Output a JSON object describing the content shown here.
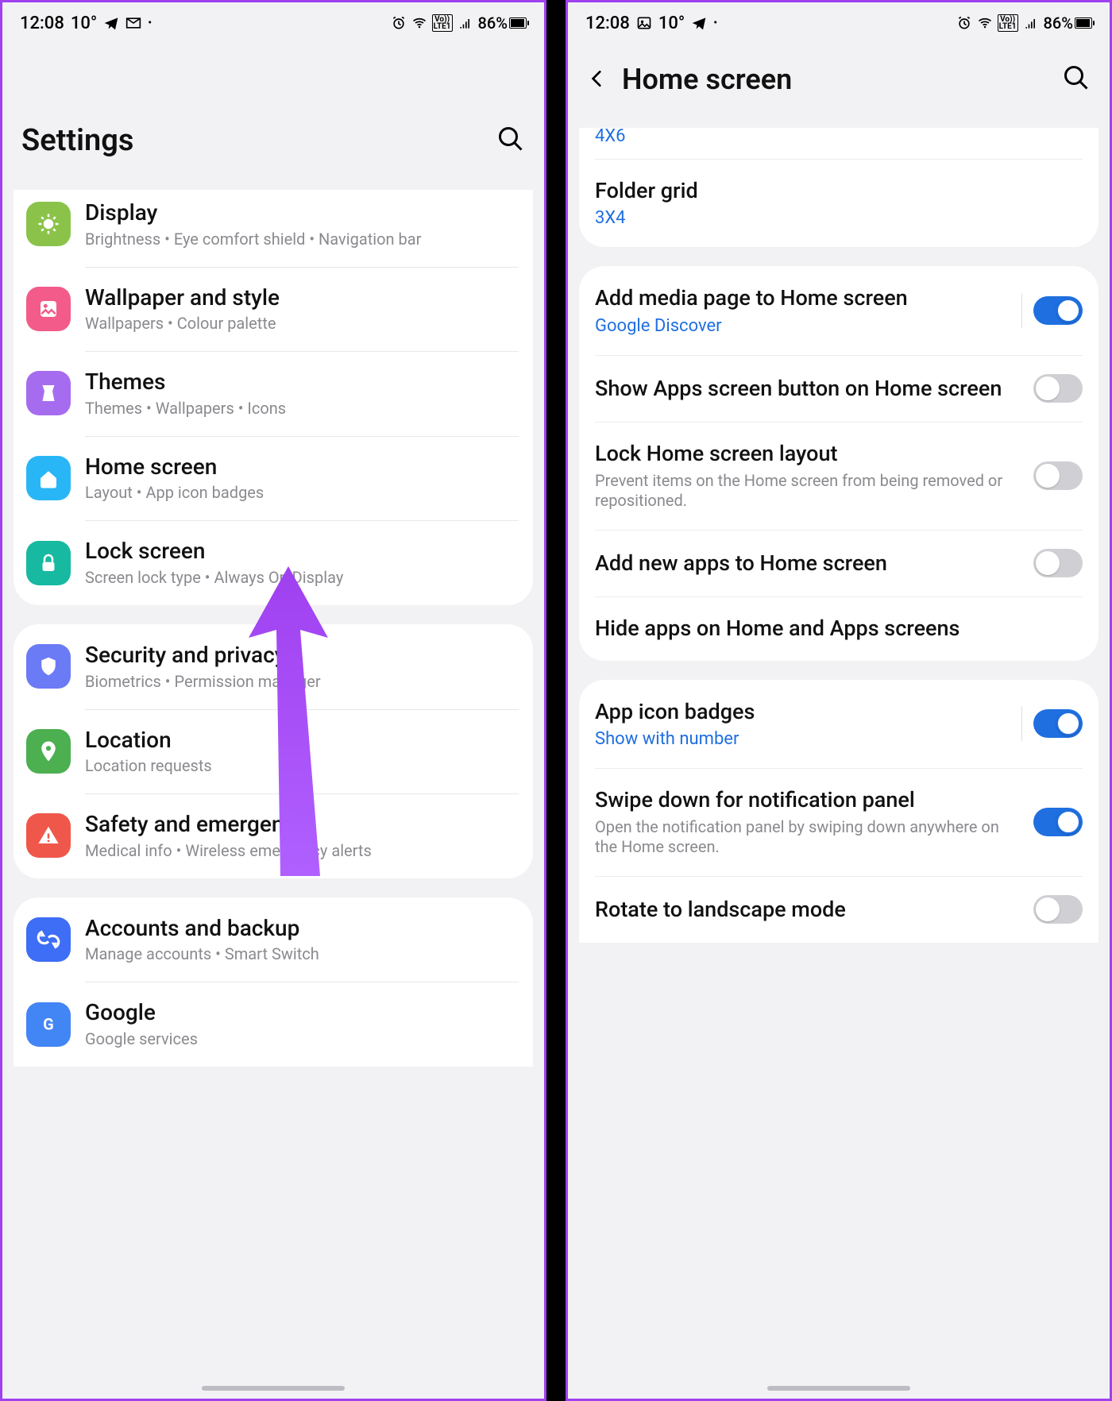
{
  "status": {
    "time": "12:08",
    "temp": "10°",
    "battery_pct": "86%"
  },
  "left": {
    "title": "Settings",
    "items": [
      {
        "title": "Display",
        "sub": "Brightness  •  Eye comfort shield  •  Navigation bar",
        "color": "#8bc34a",
        "icon": "display"
      },
      {
        "title": "Wallpaper and style",
        "sub": "Wallpapers  •  Colour palette",
        "color": "#f35b8a",
        "icon": "wallpaper"
      },
      {
        "title": "Themes",
        "sub": "Themes  •  Wallpapers  •  Icons",
        "color": "#a66cf0",
        "icon": "themes"
      },
      {
        "title": "Home screen",
        "sub": "Layout  •  App icon badges",
        "color": "#29b6f6",
        "icon": "home"
      },
      {
        "title": "Lock screen",
        "sub": "Screen lock type  •  Always On Display",
        "color": "#17b9a0",
        "icon": "lock"
      },
      {
        "title": "Security and privacy",
        "sub": "Biometrics  •  Permission manager",
        "color": "#6b7af5",
        "icon": "shield"
      },
      {
        "title": "Location",
        "sub": "Location requests",
        "color": "#4caf50",
        "icon": "location"
      },
      {
        "title": "Safety and emergency",
        "sub": "Medical info  •  Wireless emergency alerts",
        "color": "#f0574b",
        "icon": "emergency"
      },
      {
        "title": "Accounts and backup",
        "sub": "Manage accounts  •  Smart Switch",
        "color": "#3d6ef5",
        "icon": "backup"
      },
      {
        "title": "Google",
        "sub": "Google services",
        "color": "#4285f4",
        "icon": "google"
      }
    ]
  },
  "right": {
    "title": "Home screen",
    "top_value": "4X6",
    "items_a": [
      {
        "title": "Folder grid",
        "sub_blue": "3X4"
      }
    ],
    "items_b": [
      {
        "title": "Add media page to Home screen",
        "sub_blue": "Google Discover",
        "toggle": true,
        "septoggle": true
      },
      {
        "title": "Show Apps screen button on Home screen",
        "toggle": false
      },
      {
        "title": "Lock Home screen layout",
        "sub_gray": "Prevent items on the Home screen from being removed or repositioned.",
        "toggle": false
      },
      {
        "title": "Add new apps to Home screen",
        "toggle": false
      },
      {
        "title": "Hide apps on Home and Apps screens"
      }
    ],
    "items_c": [
      {
        "title": "App icon badges",
        "sub_blue": "Show with number",
        "toggle": true,
        "septoggle": true
      },
      {
        "title": "Swipe down for notification panel",
        "sub_gray": "Open the notification panel by swiping down anywhere on the Home screen.",
        "toggle": true
      },
      {
        "title": "Rotate to landscape mode",
        "toggle": false
      }
    ]
  }
}
